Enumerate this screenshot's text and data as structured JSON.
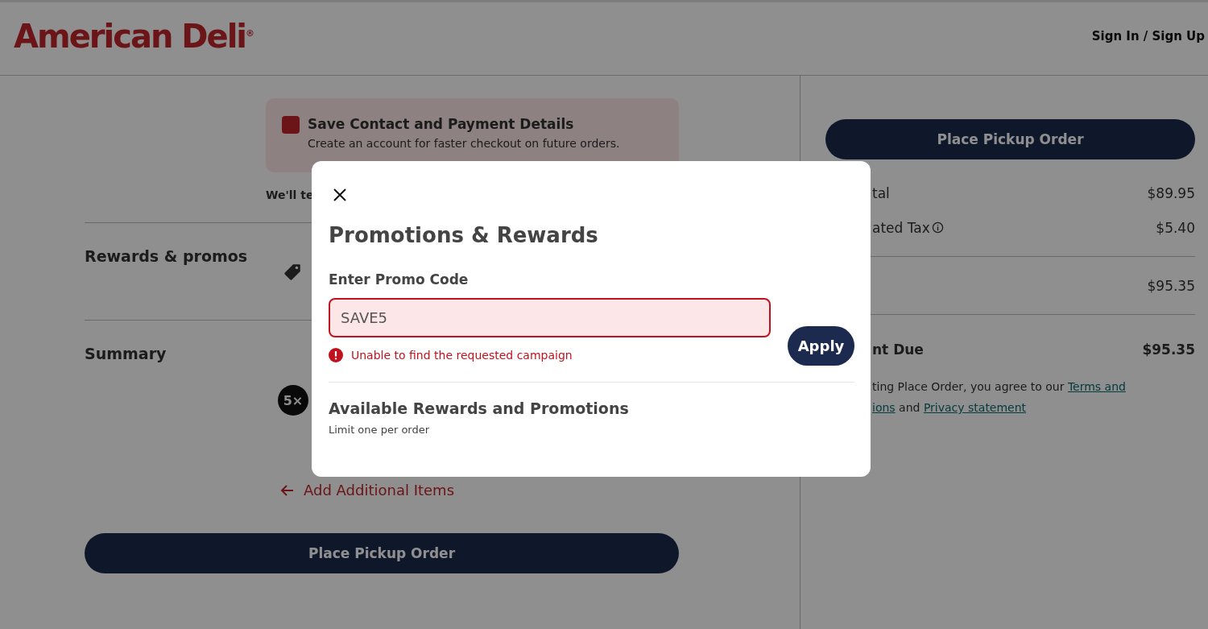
{
  "header": {
    "logo": "American Deli",
    "logo_mark": "®",
    "sign_in": "Sign In / Sign Up"
  },
  "save_card": {
    "checked": true,
    "title": "Save Contact and Payment Details",
    "description": "Create an account for faster checkout on future orders."
  },
  "notice": "We'll te",
  "rewards_section": {
    "title": "Rewards & promos"
  },
  "summary_section": {
    "title": "Summary",
    "item_badge": "5×",
    "add_items_link": "Add Additional Items"
  },
  "place_order_button": "Place Pickup Order",
  "side": {
    "place_order_button": "Place Pickup Order",
    "rows": [
      {
        "label": "tal",
        "value": "$89.95",
        "bold": false,
        "info": false,
        "divider_after": false
      },
      {
        "label": "ated Tax",
        "value": "$5.40",
        "bold": false,
        "info": true,
        "divider_after": true
      },
      {
        "label": "",
        "value": "$95.35",
        "bold": false,
        "info": false,
        "divider_after": true
      },
      {
        "label": "nt Due",
        "value": "$95.35",
        "bold": true,
        "info": false,
        "divider_after": false
      }
    ],
    "terms_lines": [
      [
        {
          "text": "ting Place Order, you agree to our ",
          "link": false
        },
        {
          "text": "Terms and",
          "link": true
        }
      ],
      [
        {
          "text": "ions",
          "link": true
        },
        {
          "text": " and ",
          "link": false
        },
        {
          "text": "Privacy statement",
          "link": true
        }
      ]
    ]
  },
  "modal": {
    "title": "Promotions & Rewards",
    "promo_label": "Enter Promo Code",
    "promo_value": "SAVE5",
    "error": "Unable to find the requested campaign",
    "apply_button": "Apply",
    "available_title": "Available Rewards and Promotions",
    "available_note": "Limit one per order"
  }
}
